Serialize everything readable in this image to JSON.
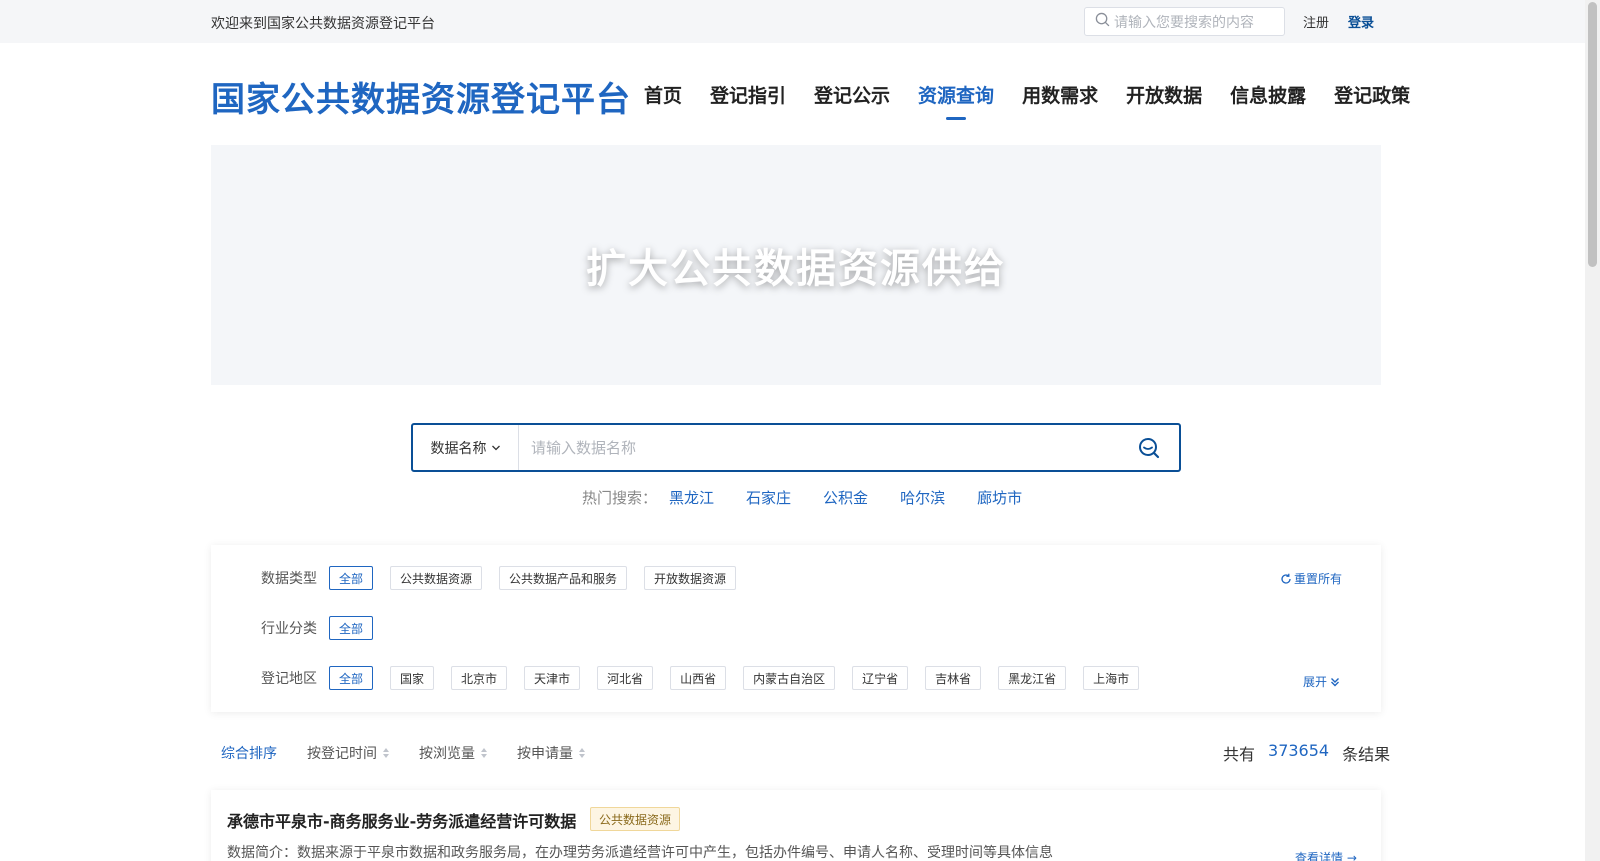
{
  "topbar": {
    "welcome": "欢迎来到国家公共数据资源登记平台",
    "search_placeholder": "请输入您要搜索的内容",
    "register": "注册",
    "login": "登录"
  },
  "header": {
    "logo": "国家公共数据资源登记平台",
    "nav": [
      "首页",
      "登记指引",
      "登记公示",
      "资源查询",
      "用数需求",
      "开放数据",
      "信息披露",
      "登记政策"
    ],
    "active_nav": "资源查询"
  },
  "banner": {
    "text": "扩大公共数据资源供给"
  },
  "search": {
    "type_label": "数据名称",
    "placeholder": "请输入数据名称",
    "hot_label": "热门搜索：",
    "hot_items": [
      "黑龙江",
      "石家庄",
      "公积金",
      "哈尔滨",
      "廊坊市"
    ]
  },
  "filters": {
    "data_type": {
      "label": "数据类型",
      "options": [
        "全部",
        "公共数据资源",
        "公共数据产品和服务",
        "开放数据资源"
      ]
    },
    "industry": {
      "label": "行业分类",
      "options": [
        "全部"
      ]
    },
    "region": {
      "label": "登记地区",
      "options": [
        "全部",
        "国家",
        "北京市",
        "天津市",
        "河北省",
        "山西省",
        "内蒙古自治区",
        "辽宁省",
        "吉林省",
        "黑龙江省",
        "上海市"
      ]
    },
    "reset_label": "重置所有",
    "expand_label": "展开"
  },
  "sort": {
    "items": [
      "综合排序",
      "按登记时间",
      "按浏览量",
      "按申请量"
    ],
    "total_prefix": "共有",
    "total_count": "373654",
    "total_suffix": "条结果"
  },
  "results": [
    {
      "title": "承德市平泉市-商务服务业-劳务派遣经营许可数据",
      "badge": "公共数据资源",
      "desc": "数据简介：数据来源于平泉市数据和政务服务局，在办理劳务派遣经营许可中产生，包括办件编号、申请人名称、受理时间等具体信息",
      "link": "查看详情"
    }
  ],
  "colors": {
    "brand": "#1f66c1",
    "dark_brand": "#0a4f96",
    "badge_bg": "#fdf5e3"
  }
}
